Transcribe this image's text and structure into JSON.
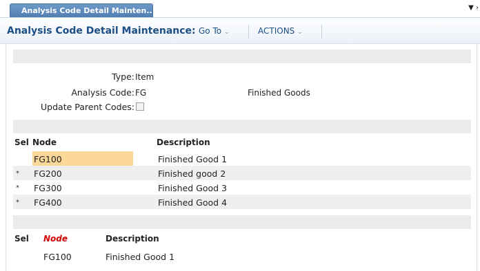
{
  "tab": {
    "label": "Analysis Code Detail Mainten...",
    "menu_icon": "dropdown-arrow-icon"
  },
  "header": {
    "title": "Analysis Code Detail Maintenance:",
    "goto_label": "Go To",
    "actions_label": "ACTIONS"
  },
  "form": {
    "type_label": "Type:",
    "type_value": "Item",
    "code_label": "Analysis Code:",
    "code_value": "FG",
    "code_description": "Finished Goods",
    "update_label": "Update Parent Codes:",
    "update_checked": false
  },
  "grid1": {
    "headers": {
      "sel": "Sel",
      "node": "Node",
      "description": "Description"
    },
    "rows": [
      {
        "sel": "",
        "node": "FG100",
        "description": "Finished Good 1",
        "highlight": true
      },
      {
        "sel": "*",
        "node": "FG200",
        "description": "Finished good 2",
        "highlight": false
      },
      {
        "sel": "*",
        "node": "FG300",
        "description": "Finished Good 3",
        "highlight": false
      },
      {
        "sel": "*",
        "node": "FG400",
        "description": "Finished Good 4",
        "highlight": false
      }
    ]
  },
  "grid2": {
    "headers": {
      "sel": "Sel",
      "node": "Node",
      "description": "Description"
    },
    "rows": [
      {
        "node": "FG100",
        "description": "Finished Good 1"
      }
    ]
  },
  "colors": {
    "title": "#1c4f86",
    "tab_bg": "#5a86b9",
    "highlight": "#fcd79a",
    "required_header": "#d40000"
  }
}
